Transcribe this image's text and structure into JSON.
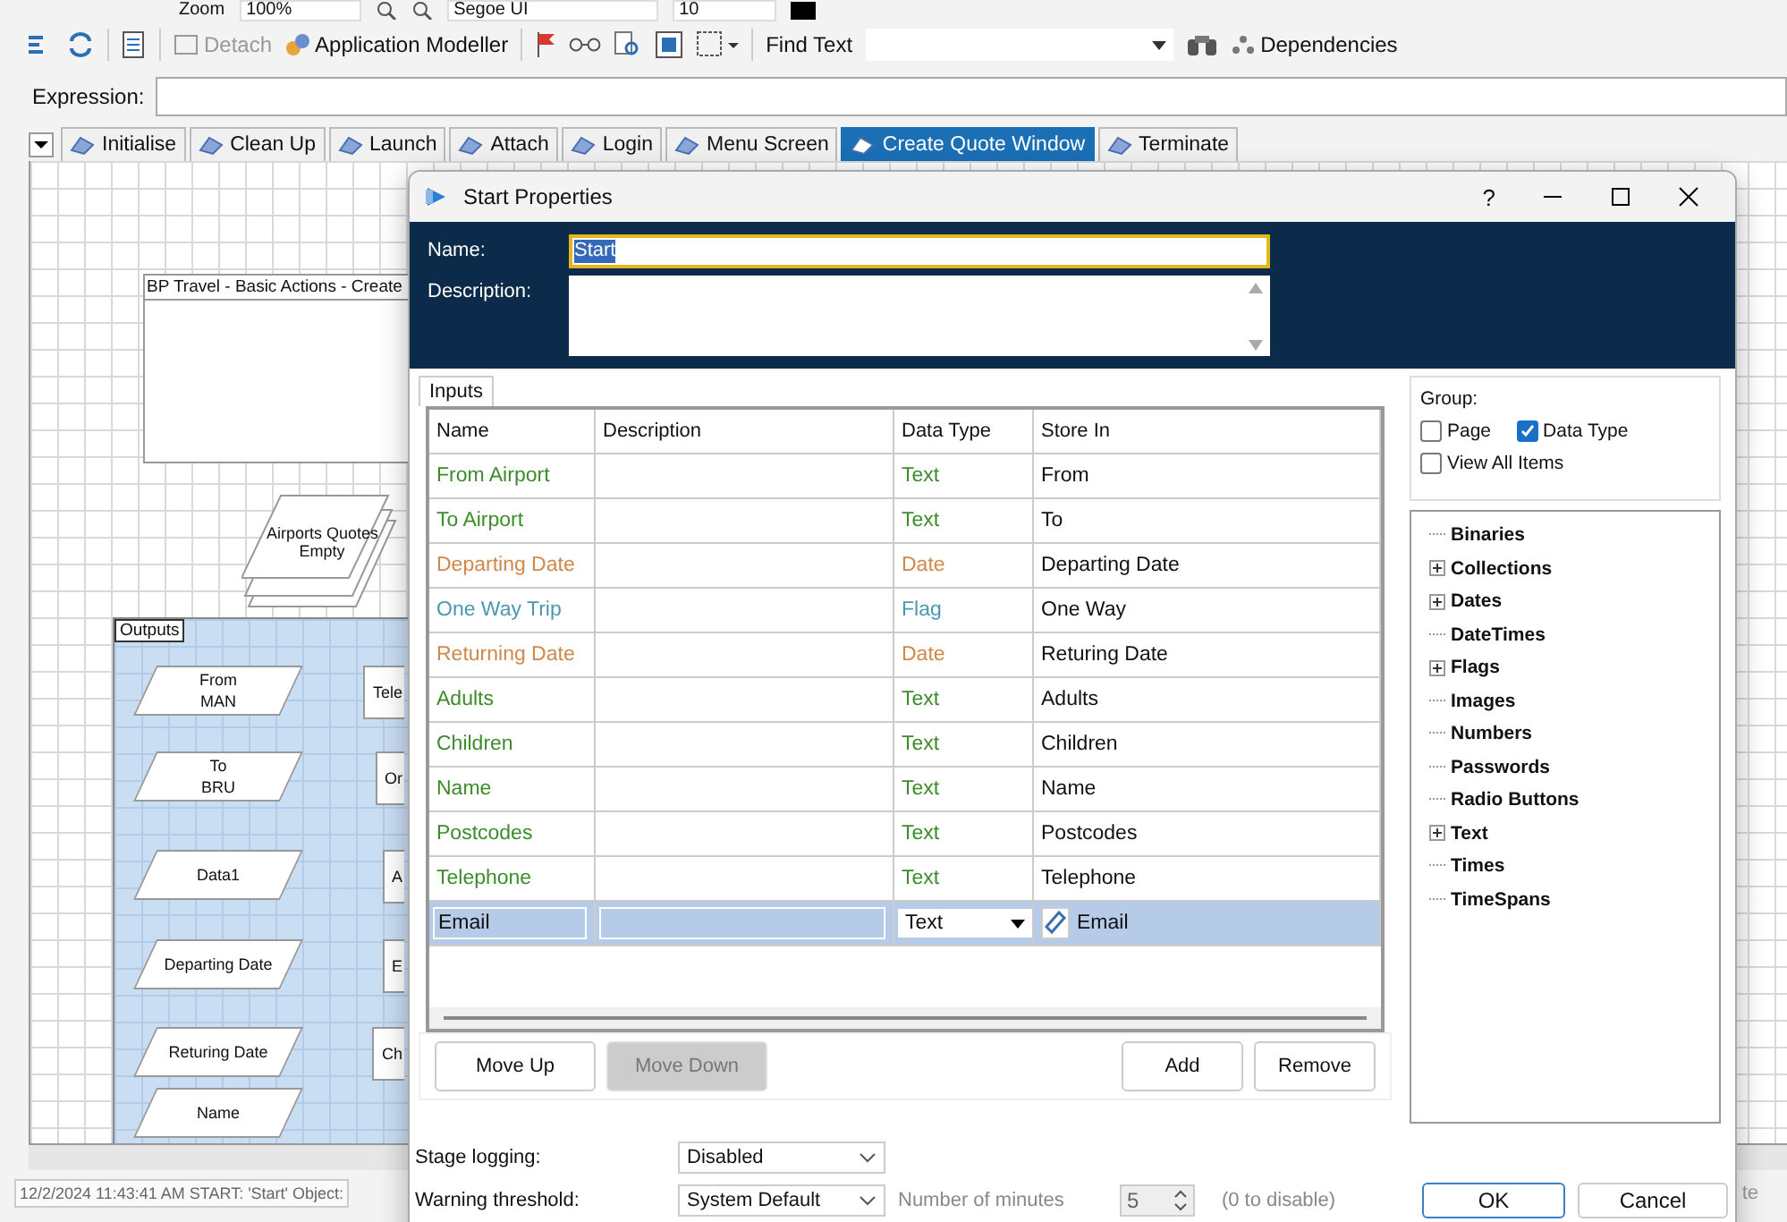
{
  "toolbar_top": {
    "zoom_label": "Zoom",
    "zoom_value": "100%",
    "font_name": "Segoe UI",
    "font_size": "10"
  },
  "toolbar": {
    "detach": {
      "label": "Detach",
      "disabled": true
    },
    "app_modeller": "Application Modeller",
    "find_label": "Find Text",
    "dependencies": "Dependencies"
  },
  "expression": {
    "label": "Expression:"
  },
  "tabs": [
    {
      "label": "Initialise",
      "selected": false
    },
    {
      "label": "Clean Up",
      "selected": false
    },
    {
      "label": "Launch",
      "selected": false
    },
    {
      "label": "Attach",
      "selected": false
    },
    {
      "label": "Login",
      "selected": false
    },
    {
      "label": "Menu Screen",
      "selected": false
    },
    {
      "label": "Create Quote Window",
      "selected": true
    },
    {
      "label": "Terminate",
      "selected": false
    }
  ],
  "canvas": {
    "note": {
      "title": "BP Travel - Basic Actions - Create"
    },
    "collection": {
      "lines": [
        "Airports Quotes",
        "Empty"
      ]
    },
    "outputs": {
      "title": "Outputs",
      "items": [
        {
          "lines": [
            "From",
            "MAN"
          ]
        },
        {
          "lines": [
            "To",
            "BRU"
          ]
        },
        {
          "lines": [
            "Data1"
          ]
        },
        {
          "lines": [
            "Departing Date"
          ]
        },
        {
          "lines": [
            "Returing Date"
          ]
        },
        {
          "lines": [
            "Name"
          ]
        }
      ],
      "right_items": [
        "Tele",
        "Or",
        "A",
        "E",
        "Ch"
      ]
    }
  },
  "dialog": {
    "title": "Start Properties",
    "help": "?",
    "name_label": "Name:",
    "name_value": "Start",
    "description_label": "Description:",
    "inputs_tab": "Inputs",
    "columns": [
      "Name",
      "Description",
      "Data Type",
      "Store In"
    ],
    "rows": [
      {
        "name": "From Airport",
        "data_type": "Text",
        "store_in": "From",
        "color": "#3c8c2c",
        "selected": false
      },
      {
        "name": "To Airport",
        "data_type": "Text",
        "store_in": "To",
        "color": "#3c8c2c",
        "selected": false
      },
      {
        "name": "Departing Date",
        "data_type": "Date",
        "store_in": "Departing Date",
        "color": "#d0884a",
        "selected": false
      },
      {
        "name": "One Way Trip",
        "data_type": "Flag",
        "store_in": "One Way",
        "color": "#4a98b0",
        "selected": false
      },
      {
        "name": "Returning Date",
        "data_type": "Date",
        "store_in": "Returing Date",
        "color": "#d0884a",
        "selected": false
      },
      {
        "name": "Adults",
        "data_type": "Text",
        "store_in": "Adults",
        "color": "#3c8c2c",
        "selected": false
      },
      {
        "name": "Children",
        "data_type": "Text",
        "store_in": "Children",
        "color": "#3c8c2c",
        "selected": false
      },
      {
        "name": "Name",
        "data_type": "Text",
        "store_in": "Name",
        "color": "#3c8c2c",
        "selected": false
      },
      {
        "name": "Postcodes",
        "data_type": "Text",
        "store_in": "Postcodes",
        "color": "#3c8c2c",
        "selected": false
      },
      {
        "name": "Telephone",
        "data_type": "Text",
        "store_in": "Telephone",
        "color": "#3c8c2c",
        "selected": false
      },
      {
        "name": "Email",
        "data_type": "Text",
        "store_in": "Email",
        "selected": true
      }
    ],
    "order_buttons": [
      {
        "label": "Move Up",
        "disabled": false
      },
      {
        "label": "Move Down",
        "disabled": true
      }
    ],
    "edit_buttons": [
      {
        "label": "Add",
        "disabled": false
      },
      {
        "label": "Remove",
        "disabled": false
      }
    ],
    "group": {
      "label": "Group:",
      "options": [
        {
          "label": "Page",
          "checked": false
        },
        {
          "label": "Data Type",
          "checked": true
        },
        {
          "label": "View All Items",
          "checked": false
        }
      ]
    },
    "tree": [
      {
        "label": "Binaries",
        "has_children": false
      },
      {
        "label": "Collections",
        "has_children": true
      },
      {
        "label": "Dates",
        "has_children": true
      },
      {
        "label": "DateTimes",
        "has_children": false
      },
      {
        "label": "Flags",
        "has_children": true
      },
      {
        "label": "Images",
        "has_children": false
      },
      {
        "label": "Numbers",
        "has_children": false
      },
      {
        "label": "Passwords",
        "has_children": false
      },
      {
        "label": "Radio Buttons",
        "has_children": false
      },
      {
        "label": "Text",
        "has_children": true
      },
      {
        "label": "Times",
        "has_children": false
      },
      {
        "label": "TimeSpans",
        "has_children": false
      }
    ],
    "stage_logging": {
      "label": "Stage logging:",
      "value": "Disabled"
    },
    "warning": {
      "label": "Warning threshold:",
      "value": "System Default",
      "minutes_label": "Number of minutes",
      "minutes_value": "5",
      "hint": "(0 to disable)"
    },
    "ok": "OK",
    "cancel": "Cancel"
  },
  "status_bar": {
    "message": "12/2/2024 11:43:41 AM START: 'Start' Object:",
    "right_fragment": "te"
  }
}
